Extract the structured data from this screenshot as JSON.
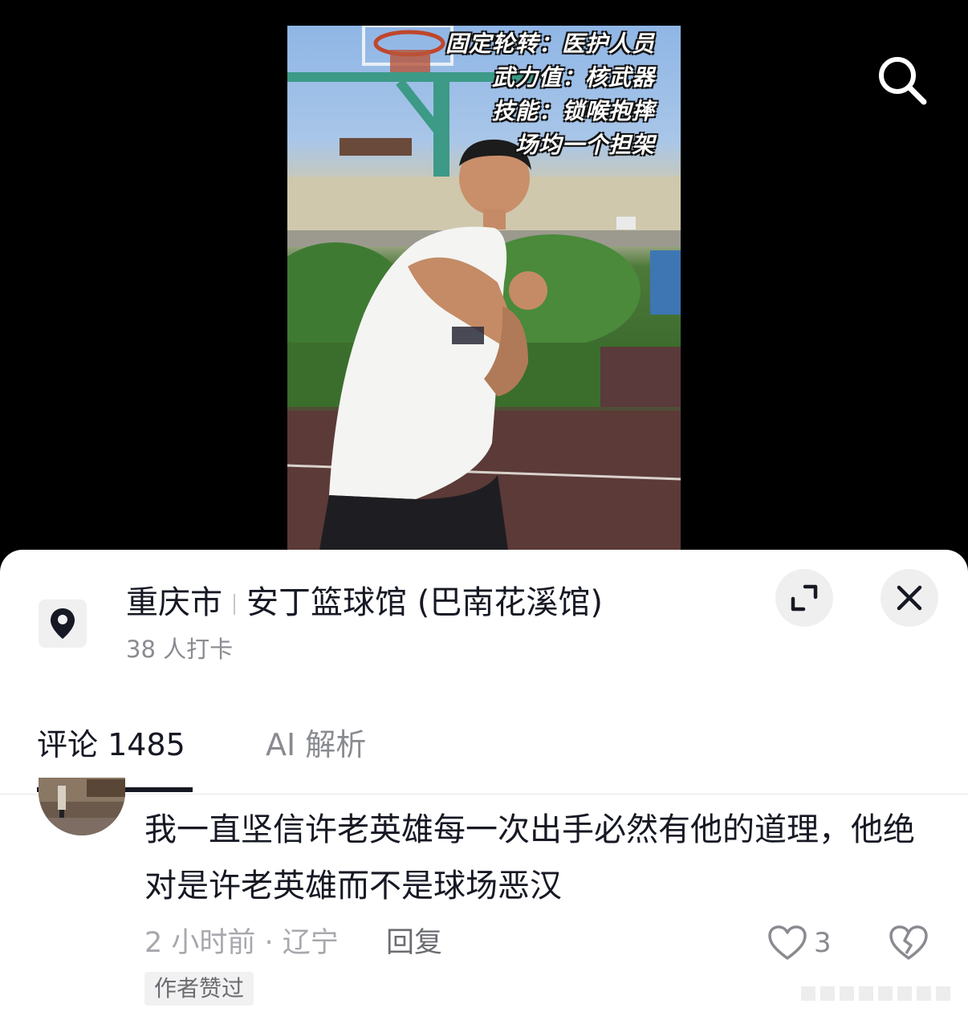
{
  "video": {
    "overlay_lines": [
      "固定轮转：医护人员",
      "武力值：核武器",
      "技能：锁喉抱摔",
      "场均一个担架"
    ],
    "search_icon": "search-icon"
  },
  "location": {
    "icon": "map-pin-icon",
    "city": "重庆市",
    "venue": "安丁篮球馆 (巴南花溪馆)",
    "checkins": "38 人打卡",
    "expand_icon": "expand-icon",
    "close_icon": "close-icon"
  },
  "tabs": [
    {
      "label": "评论 1485",
      "active": true
    },
    {
      "label": "AI 解析",
      "active": false
    }
  ],
  "comment": {
    "text": "我一直坚信许老英雄每一次出手必然有他的道理，他绝对是许老英雄而不是球场恶汉",
    "meta": "2 小时前 · 辽宁",
    "reply_label": "回复",
    "like_count": "3",
    "like_icon": "heart-icon",
    "dislike_icon": "broken-heart-icon",
    "badge": "作者赞过"
  },
  "colors": {
    "text_primary": "#161823",
    "text_secondary": "#8a8b91",
    "sheet_bg": "#ffffff",
    "button_bg": "#efefef"
  }
}
